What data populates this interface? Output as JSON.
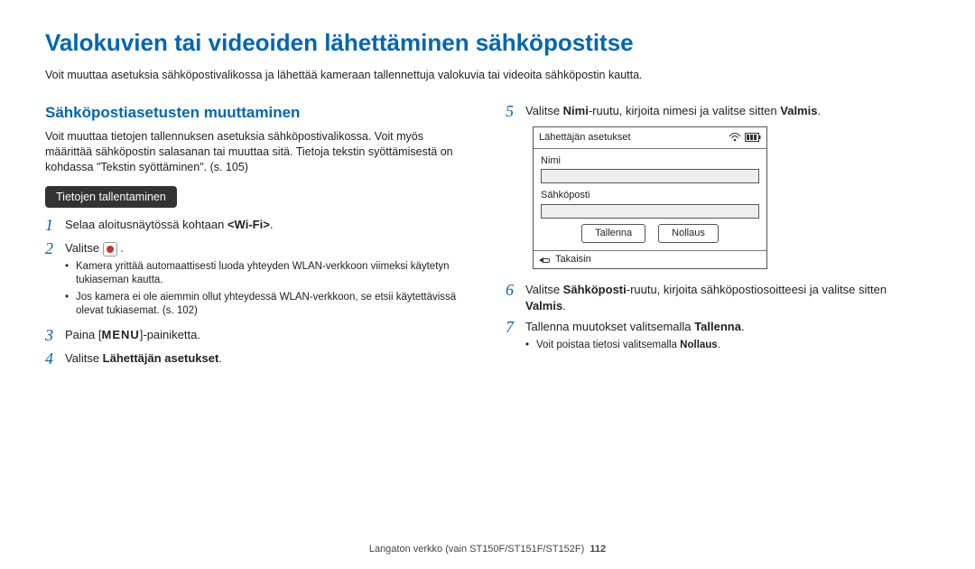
{
  "title": "Valokuvien tai videoiden lähettäminen sähköpostitse",
  "intro": "Voit muuttaa asetuksia sähköpostivalikossa ja lähettää kameraan tallennettuja valokuvia tai videoita sähköpostin kautta.",
  "left": {
    "subhead": "Sähköpostiasetusten muuttaminen",
    "desc": "Voit muuttaa tietojen tallennuksen asetuksia sähköpostivalikossa. Voit myös määrittää sähköpostin salasanan tai muuttaa sitä. Tietoja tekstin syöttämisestä on kohdassa \"Tekstin syöttäminen\". (s. 105)",
    "pill": "Tietojen tallentaminen",
    "step1_a": "Selaa aloitusnäytössä kohtaan ",
    "step1_b": "<Wi-Fi>",
    "step1_c": ".",
    "step2_a": "Valitse ",
    "step2_b": " .",
    "bullets": [
      "Kamera yrittää automaattisesti luoda yhteyden WLAN-verkkoon viimeksi käytetyn tukiaseman kautta.",
      "Jos kamera ei ole aiemmin ollut yhteydessä WLAN-verkkoon, se etsii käytettävissä olevat tukiasemat. (s. 102)"
    ],
    "step3_a": "Paina [",
    "step3_menu": "MENU",
    "step3_b": "]-painiketta.",
    "step4_a": "Valitse ",
    "step4_b": "Lähettäjän asetukset",
    "step4_c": "."
  },
  "right": {
    "step5_a": "Valitse ",
    "step5_b": "Nimi",
    "step5_c": "-ruutu, kirjoita nimesi ja valitse sitten ",
    "step5_d": "Valmis",
    "step5_e": ".",
    "device": {
      "header": "Lähettäjän asetukset",
      "label1": "Nimi",
      "label2": "Sähköposti",
      "btn_save": "Tallenna",
      "btn_reset": "Nollaus",
      "back": "Takaisin"
    },
    "step6_a": "Valitse ",
    "step6_b": "Sähköposti",
    "step6_c": "-ruutu, kirjoita sähköpostiosoitteesi ja valitse sitten ",
    "step6_d": "Valmis",
    "step6_e": ".",
    "step7_a": "Tallenna muutokset valitsemalla ",
    "step7_b": "Tallenna",
    "step7_c": ".",
    "bullet7_a": "Voit poistaa tietosi valitsemalla ",
    "bullet7_b": "Nollaus",
    "bullet7_c": "."
  },
  "footer_text": "Langaton verkko (vain ST150F/ST151F/ST152F)",
  "footer_page": "112"
}
